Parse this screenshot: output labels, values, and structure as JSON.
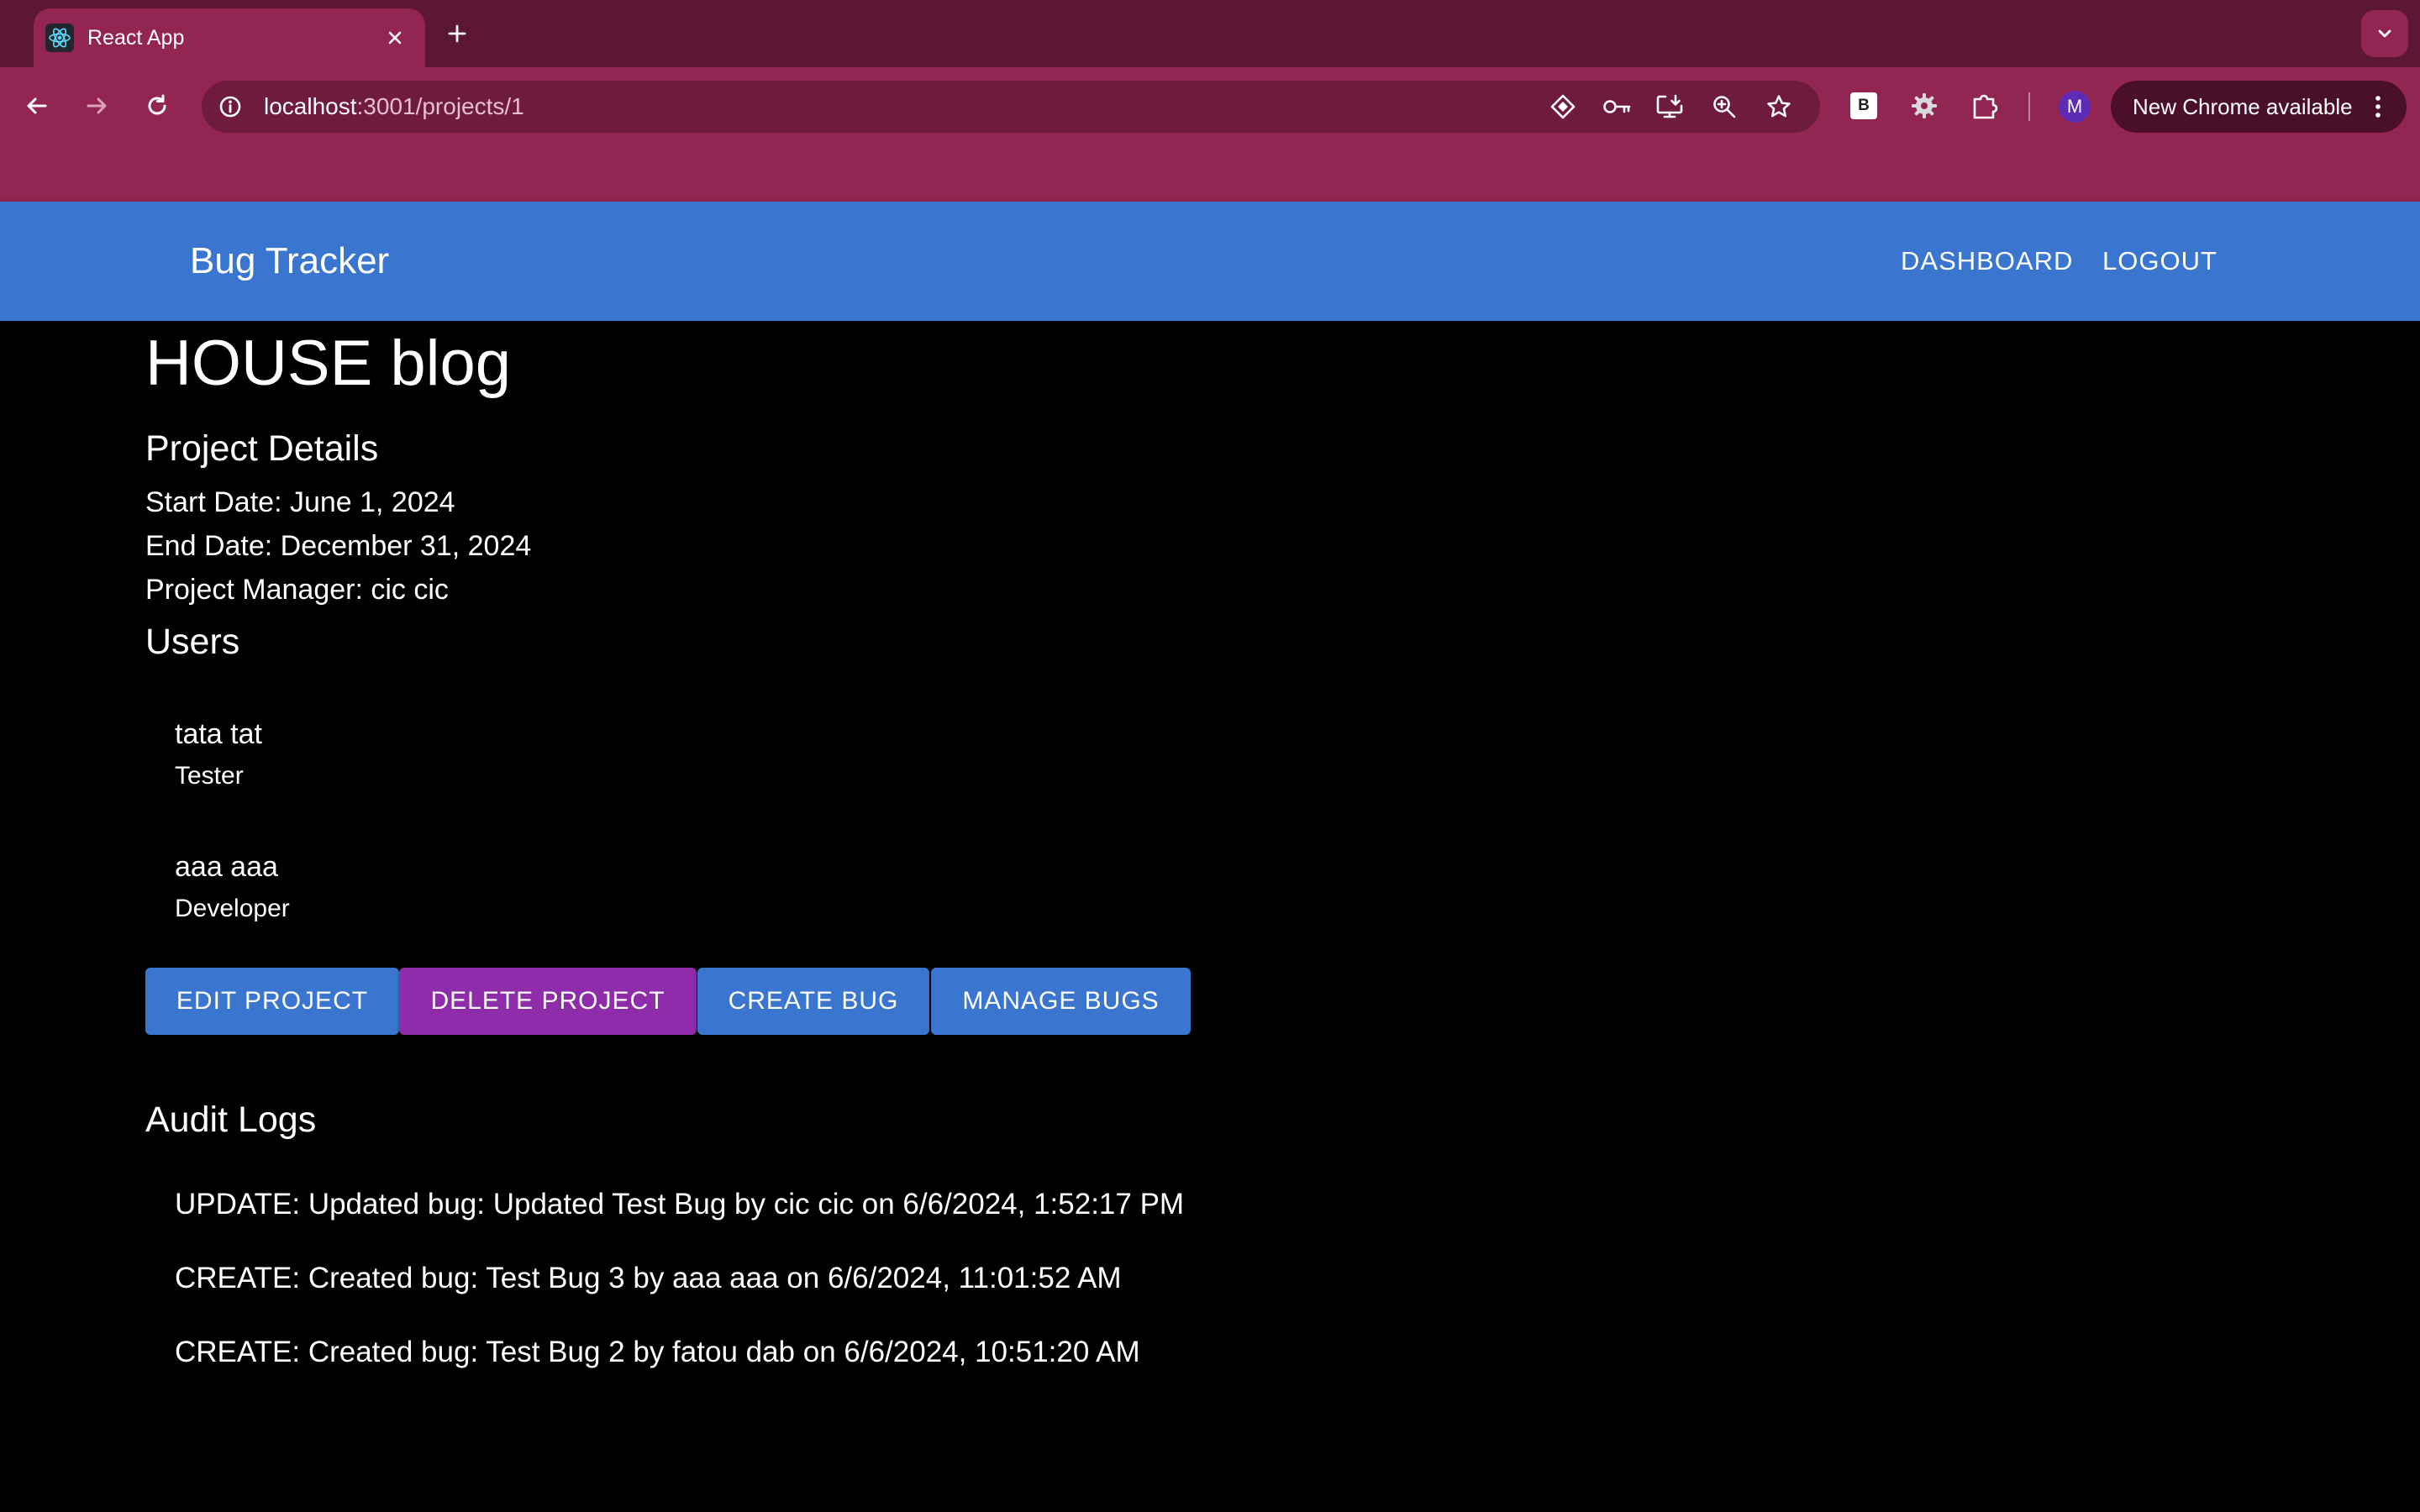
{
  "browser": {
    "tab_title": "React App",
    "url_host": "localhost",
    "url_path": ":3001/projects/1",
    "extension_badge": "B",
    "profile_initial": "M",
    "update_label": "New Chrome available"
  },
  "appbar": {
    "brand": "Bug Tracker",
    "links": [
      "DASHBOARD",
      "LOGOUT"
    ]
  },
  "project": {
    "title": "HOUSE blog",
    "details_heading": "Project Details",
    "start_date": "Start Date: June 1, 2024",
    "end_date": "End Date: December 31, 2024",
    "manager": "Project Manager: cic cic"
  },
  "users": {
    "heading": "Users",
    "items": [
      {
        "name": "tata tat",
        "role": "Tester"
      },
      {
        "name": "aaa aaa",
        "role": "Developer"
      }
    ]
  },
  "actions": {
    "edit": "EDIT PROJECT",
    "delete": "DELETE PROJECT",
    "create_bug": "CREATE BUG",
    "manage_bugs": "MANAGE BUGS"
  },
  "audit": {
    "heading": "Audit Logs",
    "entries": [
      "UPDATE: Updated bug: Updated Test Bug by cic cic on 6/6/2024, 1:52:17 PM",
      "CREATE: Created bug: Test Bug 3 by aaa aaa on 6/6/2024, 11:01:52 AM",
      "CREATE: Created bug: Test Bug 2 by fatou dab on 6/6/2024, 10:51:20 AM"
    ]
  },
  "colors": {
    "tabstrip": "#5c1734",
    "toolbar": "#922552",
    "appbar": "#3a76cf",
    "button_primary": "#3a76cf",
    "button_danger": "#8e2ca9",
    "background": "#000000"
  }
}
